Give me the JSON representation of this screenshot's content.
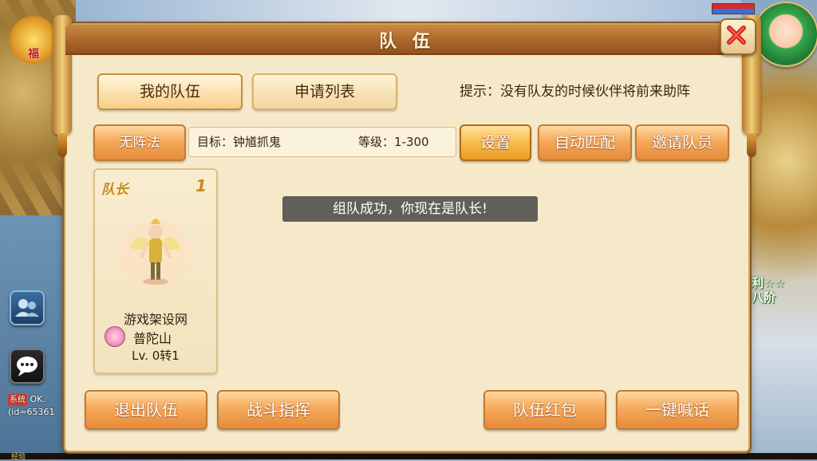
{
  "window": {
    "title": "队 伍"
  },
  "tabs": [
    {
      "label": "我的队伍",
      "active": true
    },
    {
      "label": "申请列表",
      "active": false
    }
  ],
  "hint": "提示：没有队友的时候伙伴将前来助阵",
  "toolbar": {
    "formation_label": "无阵法",
    "target_text": "目标：钟馗抓鬼",
    "level_text": "等级：1-300",
    "settings_label": "设置",
    "auto_match_label": "自动匹配",
    "invite_label": "邀请队员"
  },
  "member": {
    "role": "队长",
    "slot": "1",
    "name": "游戏架设网",
    "school": "普陀山",
    "level": "Lv. 0转1"
  },
  "toast": "组队成功，你现在是队长!",
  "bottom_buttons": {
    "quit": "退出队伍",
    "command": "战斗指挥",
    "red_packet": "队伍红包",
    "shout": "一键喊话"
  },
  "background": {
    "fu_badge": "福",
    "system_tag": "系统",
    "system_message": "OK.",
    "system_id": "(id=65361",
    "right_tag_line1": "福利☆☆",
    "right_tag_line2": "到八阶",
    "exp_label": "经验"
  },
  "colors": {
    "panel_bg": "#f6e9c9",
    "title_bar": "#a8652a",
    "button_orange": "#f5a95b",
    "toast_bg": "#464646"
  },
  "icons": [
    "close-icon",
    "friends-icon",
    "chat-bubble-icon",
    "lotus-icon"
  ]
}
